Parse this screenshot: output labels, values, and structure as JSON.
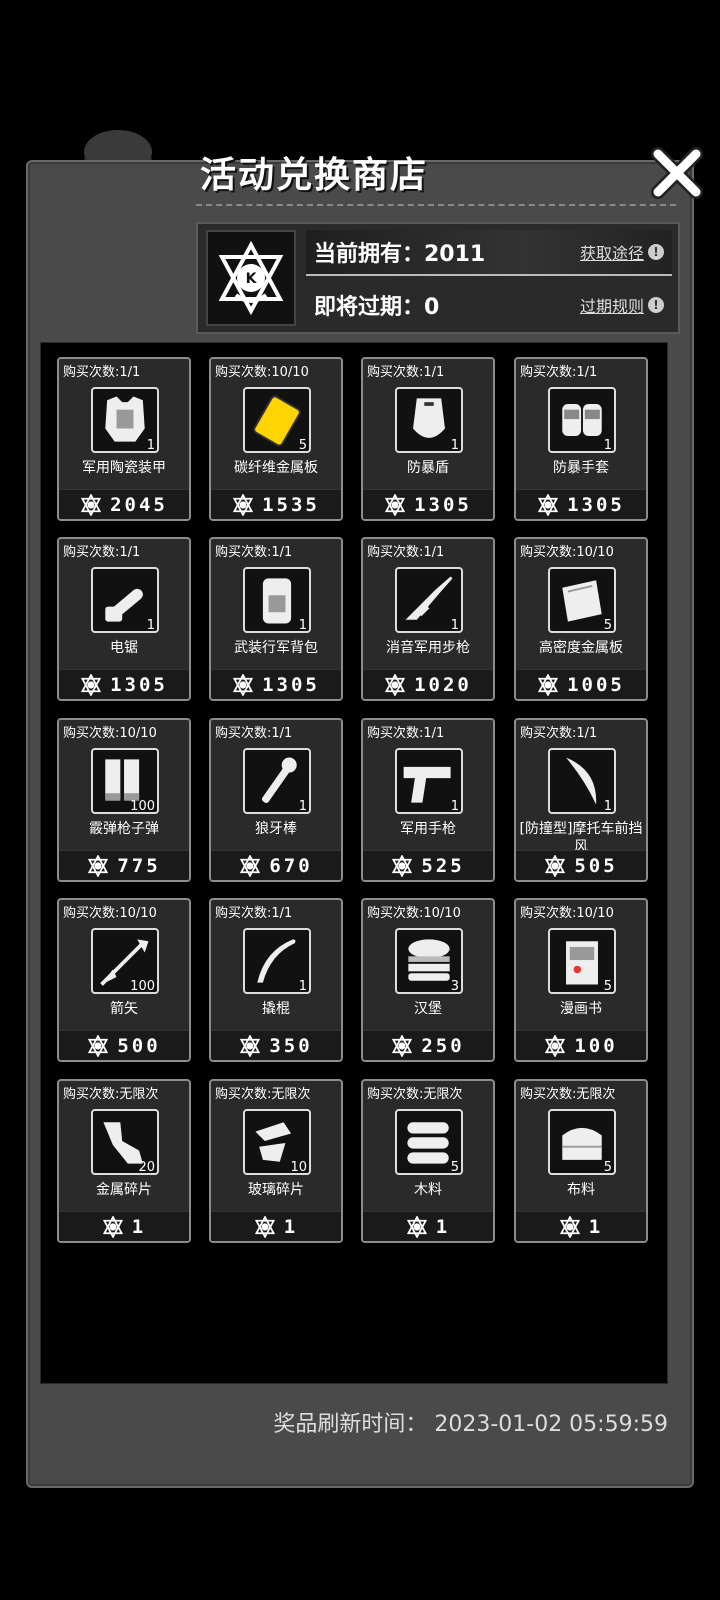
{
  "header": {
    "title": "活动兑换商店"
  },
  "currency": {
    "owned_label": "当前拥有：2011",
    "expiring_label": "即将过期：0",
    "obtain_link": "获取途径",
    "expire_rules_link": "过期规则"
  },
  "items": [
    {
      "limit": "购买次数:1/1",
      "name": "军用陶瓷装甲",
      "qty": "1",
      "price": "2045",
      "icon": "armor-vest-icon"
    },
    {
      "limit": "购买次数:10/10",
      "name": "碳纤维金属板",
      "qty": "5",
      "price": "1535",
      "icon": "metal-plate-icon"
    },
    {
      "limit": "购买次数:1/1",
      "name": "防暴盾",
      "qty": "1",
      "price": "1305",
      "icon": "riot-shield-icon"
    },
    {
      "limit": "购买次数:1/1",
      "name": "防暴手套",
      "qty": "1",
      "price": "1305",
      "icon": "gloves-icon"
    },
    {
      "limit": "购买次数:1/1",
      "name": "电锯",
      "qty": "1",
      "price": "1305",
      "icon": "chainsaw-icon"
    },
    {
      "limit": "购买次数:1/1",
      "name": "武装行军背包",
      "qty": "1",
      "price": "1305",
      "icon": "backpack-icon"
    },
    {
      "limit": "购买次数:1/1",
      "name": "消音军用步枪",
      "qty": "1",
      "price": "1020",
      "icon": "rifle-icon"
    },
    {
      "limit": "购买次数:10/10",
      "name": "高密度金属板",
      "qty": "5",
      "price": "1005",
      "icon": "dense-plate-icon"
    },
    {
      "limit": "购买次数:10/10",
      "name": "霰弹枪子弹",
      "qty": "100",
      "price": "775",
      "icon": "shotgun-shells-icon"
    },
    {
      "limit": "购买次数:1/1",
      "name": "狼牙棒",
      "qty": "1",
      "price": "670",
      "icon": "spiked-club-icon"
    },
    {
      "limit": "购买次数:1/1",
      "name": "军用手枪",
      "qty": "1",
      "price": "525",
      "icon": "pistol-icon"
    },
    {
      "limit": "购买次数:1/1",
      "name": "[防撞型]摩托车前挡风",
      "qty": "1",
      "price": "505",
      "icon": "windshield-icon"
    },
    {
      "limit": "购买次数:10/10",
      "name": "箭矢",
      "qty": "100",
      "price": "500",
      "icon": "arrow-icon"
    },
    {
      "limit": "购买次数:1/1",
      "name": "撬棍",
      "qty": "1",
      "price": "350",
      "icon": "crowbar-icon"
    },
    {
      "limit": "购买次数:10/10",
      "name": "汉堡",
      "qty": "3",
      "price": "250",
      "icon": "burger-icon"
    },
    {
      "limit": "购买次数:10/10",
      "name": "漫画书",
      "qty": "5",
      "price": "100",
      "icon": "comic-book-icon"
    },
    {
      "limit": "购买次数:无限次",
      "name": "金属碎片",
      "qty": "20",
      "price": "1",
      "icon": "metal-scrap-icon"
    },
    {
      "limit": "购买次数:无限次",
      "name": "玻璃碎片",
      "qty": "10",
      "price": "1",
      "icon": "glass-shard-icon"
    },
    {
      "limit": "购买次数:无限次",
      "name": "木料",
      "qty": "5",
      "price": "1",
      "icon": "wood-logs-icon"
    },
    {
      "limit": "购买次数:无限次",
      "name": "布料",
      "qty": "5",
      "price": "1",
      "icon": "cloth-icon"
    }
  ],
  "footer": {
    "refresh_text": "奖品刷新时间：  2023-01-02 05:59:59"
  }
}
